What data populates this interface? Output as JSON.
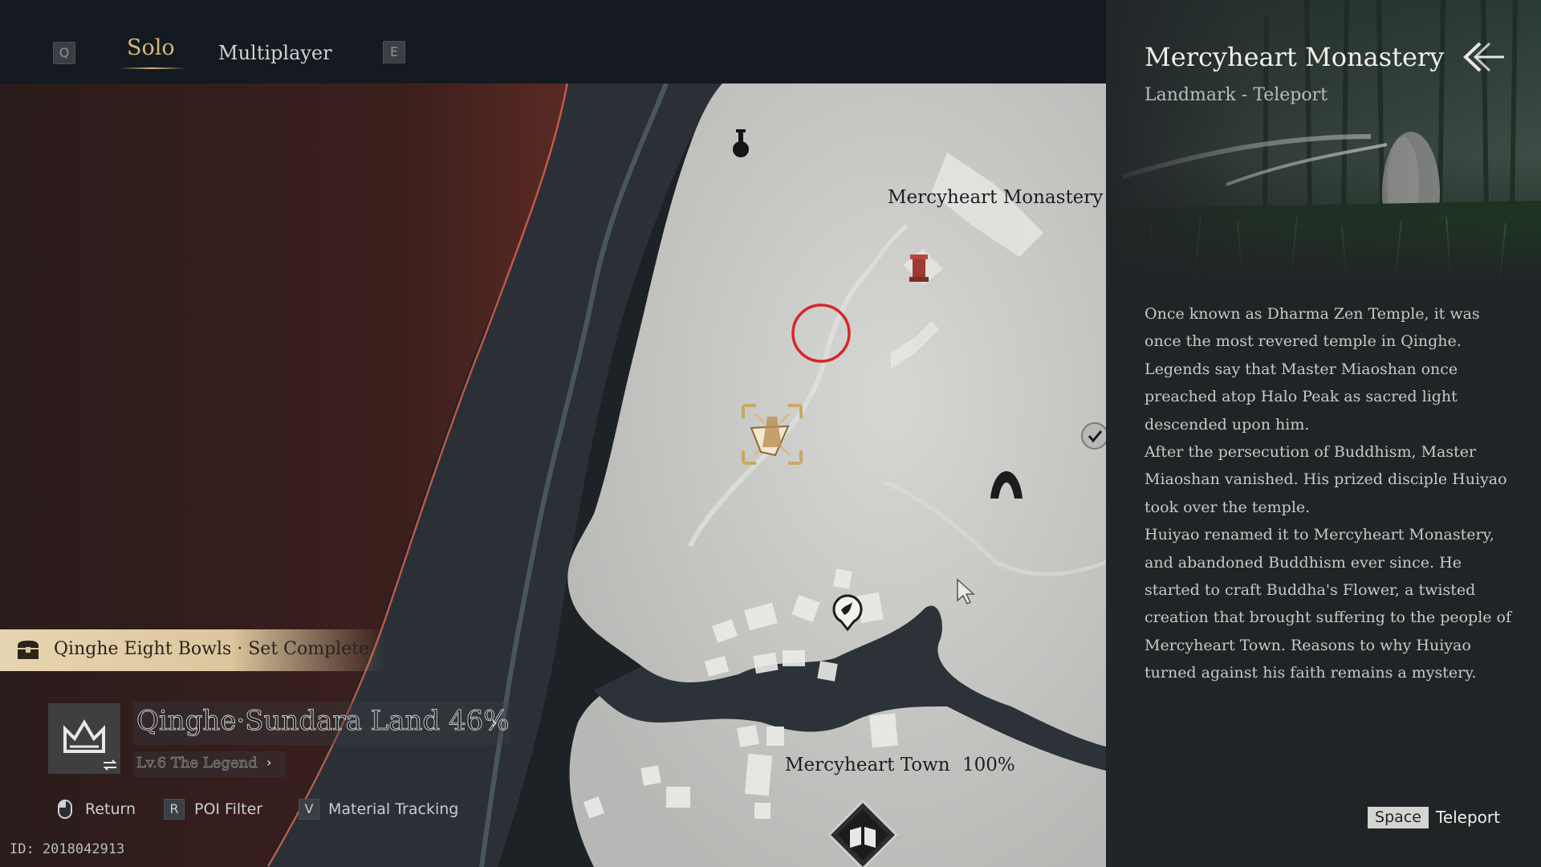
{
  "mode_tabs": {
    "left_key": "Q",
    "right_key": "E",
    "solo": "Solo",
    "multiplayer": "Multiplayer",
    "active": "Solo"
  },
  "map": {
    "labels": {
      "monastery": "Mercyheart Monastery",
      "town": "Mercyheart Town",
      "town_progress": "100%"
    }
  },
  "notification": {
    "text": "Qinghe Eight Bowls · Set Complete"
  },
  "region": {
    "name": "Qinghe·Sundara Land 46%",
    "level": "Lv.6 The Legend",
    "exploration_percent": 46
  },
  "controls": {
    "return_label": "Return",
    "poi_key": "R",
    "poi_label": "POI Filter",
    "material_key": "V",
    "material_label": "Material Tracking"
  },
  "player_id": "ID: 2018042913",
  "detail_panel": {
    "title": "Mercyheart Monastery",
    "subtitle": "Landmark - Teleport",
    "description": [
      "Once known as Dharma Zen Temple, it was once the most revered temple in Qinghe.",
      "Legends say that Master Miaoshan once preached atop Halo Peak as sacred light descended upon him.",
      "After the persecution of Buddhism, Master Miaoshan vanished. His prized disciple Huiyao took over the temple.",
      "Huiyao renamed it to Mercyheart Monastery, and abandoned Buddhism ever since. He started to craft Buddha's Flower, a twisted creation that brought suffering to the people of Mercyheart Town. Reasons to why Huiyao turned against his faith remains a mystery."
    ],
    "action_key": "Space",
    "action_label": "Teleport"
  },
  "colors": {
    "accent_gold": "#d8b67a",
    "target_circle": "#d6262b",
    "panel_bg": "#212427",
    "map_land": "#c9c9c6"
  }
}
